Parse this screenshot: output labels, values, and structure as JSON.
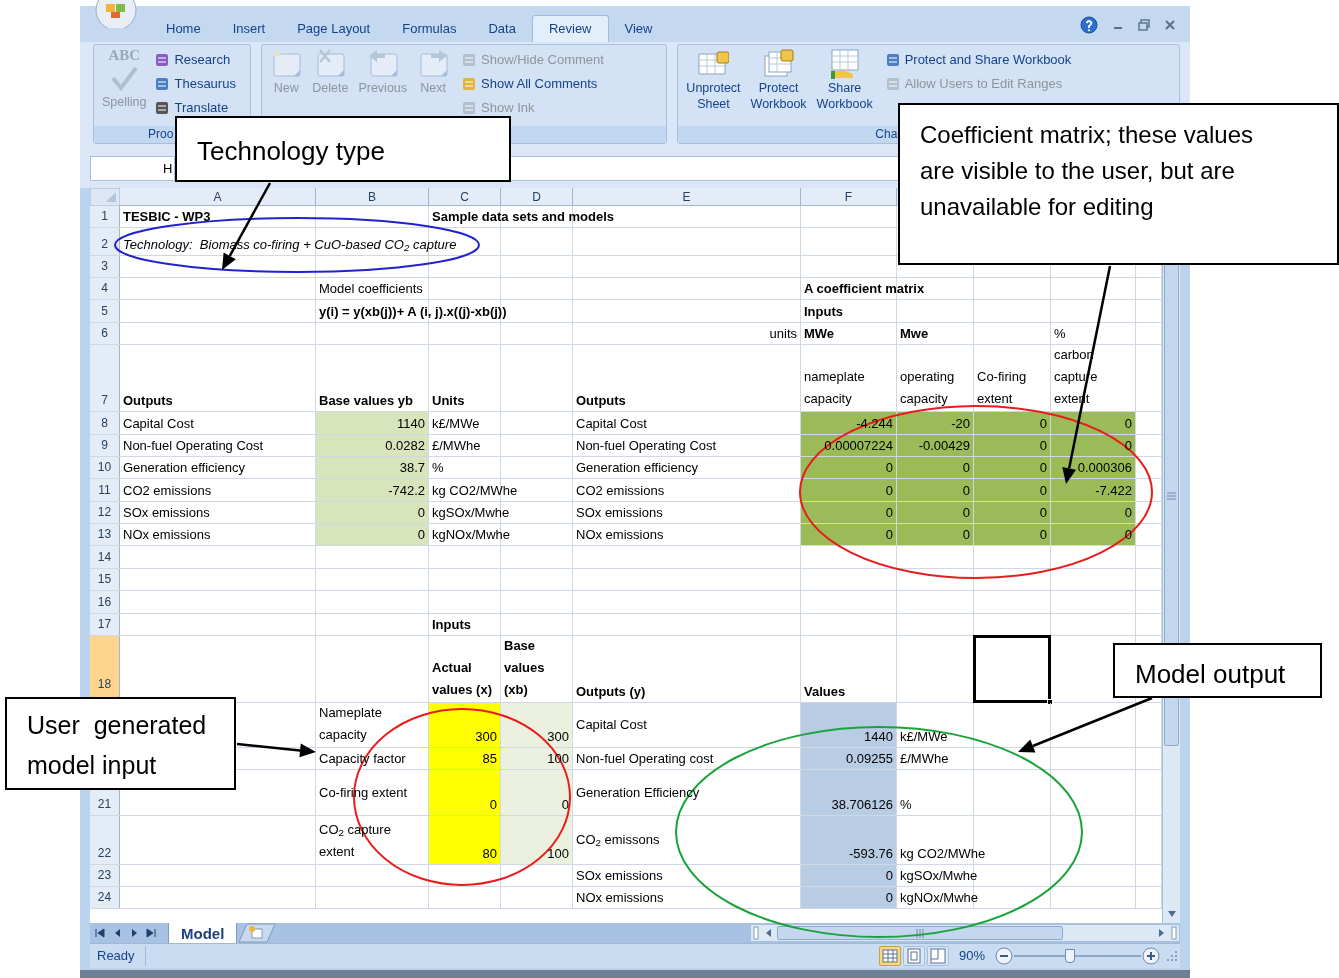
{
  "ribbon": {
    "tabs": [
      {
        "label": "Home",
        "selected": false
      },
      {
        "label": "Insert",
        "selected": false
      },
      {
        "label": "Page Layout",
        "selected": false
      },
      {
        "label": "Formulas",
        "selected": false
      },
      {
        "label": "Data",
        "selected": false
      },
      {
        "label": "Review",
        "selected": true
      },
      {
        "label": "View",
        "selected": false
      }
    ],
    "groups": [
      {
        "label": "Proo",
        "large_buttons": [
          {
            "label": "Spelling",
            "icon_text": "ABC",
            "disabled": true
          }
        ],
        "small_buttons": [
          {
            "label": "Research",
            "disabled": false
          },
          {
            "label": "Thesaurus",
            "disabled": false
          },
          {
            "label": "Translate",
            "disabled": false
          }
        ]
      },
      {
        "large_buttons": [
          {
            "label": "New",
            "disabled": true
          },
          {
            "label": "Delete",
            "disabled": true
          },
          {
            "label": "Previous",
            "disabled": true
          },
          {
            "label": "Next",
            "disabled": true
          }
        ],
        "small_buttons": [
          {
            "label": "Show/Hide Comment",
            "disabled": true
          },
          {
            "label": "Show All Comments",
            "disabled": false
          },
          {
            "label": "Show Ink",
            "disabled": true
          }
        ]
      },
      {
        "label": "Cha",
        "large_buttons": [
          {
            "label": "Unprotect Sheet",
            "disabled": false
          },
          {
            "label": "Protect Workbook",
            "disabled": false
          },
          {
            "label": "Share Workbook",
            "disabled": false
          }
        ],
        "small_buttons": [
          {
            "label": "Protect and Share Workbook",
            "disabled": false
          },
          {
            "label": "Allow Users to Edit Ranges",
            "disabled": true
          }
        ]
      }
    ]
  },
  "formula_bar": {
    "name_box": "H"
  },
  "sheet": {
    "columns": [
      "A",
      "B",
      "C",
      "D",
      "E",
      "F"
    ],
    "rows": [
      {
        "number": "1",
        "cells": {
          "col_a": {
            "text": "TESBIC - WP3",
            "bold": true
          },
          "col_c": {
            "text": "Sample data sets and models",
            "bold": true
          }
        }
      },
      {
        "number": "2",
        "cells": {
          "col_a": {
            "text": "Technology:  Biomass co-firing + CuO-based CO$_{2}$ capture",
            "italic": true
          }
        }
      },
      {
        "number": "3"
      },
      {
        "number": "4",
        "cells": {
          "col_b": {
            "text": "Model coefficients"
          },
          "col_f": {
            "text": "A coefficient matrix",
            "bold": true
          }
        }
      },
      {
        "number": "5",
        "cells": {
          "col_b": {
            "text": "y(i) = y(xb(j))+ A (i, j).x((j)-xb(j))",
            "bold": true
          },
          "col_f": {
            "text": "Inputs",
            "bold": true
          }
        }
      },
      {
        "number": "6",
        "cells": {
          "col_e": {
            "text": "units",
            "right_aligned": true
          },
          "col_f": {
            "text": "MWe",
            "bold": true
          },
          "col_g": {
            "text": "Mwe",
            "bold": true
          },
          "col_i": {
            "text": "%"
          }
        }
      },
      {
        "number": "7",
        "cells": {
          "col_a": {
            "text": "Outputs",
            "bold": true
          },
          "col_b": {
            "text": "Base values yb",
            "bold": true
          },
          "col_c": {
            "text": "Units",
            "bold": true
          },
          "col_e": {
            "text": "Outputs",
            "bold": true
          },
          "col_f": {
            "text": "nameplate capacity",
            "wrap": true
          },
          "col_g": {
            "text": "operating capacity",
            "wrap": true
          },
          "col_h": {
            "text": "Co-firing extent",
            "wrap": true
          },
          "col_i": {
            "text": "carbon capture extent",
            "wrap": true
          }
        }
      },
      {
        "number": "8",
        "cells": {
          "col_a": {
            "text": "Capital Cost"
          },
          "col_b": {
            "text": "1140",
            "right_aligned": true,
            "color": "#d8e4bc"
          },
          "col_c": {
            "text": "k£/MWe"
          },
          "col_e": {
            "text": "Capital Cost"
          },
          "col_f": {
            "text": "-4.244",
            "right_aligned": true,
            "color": "#9bbb59"
          },
          "col_g": {
            "text": "-20",
            "right_aligned": true,
            "color": "#9bbb59"
          },
          "col_h": {
            "text": "0",
            "right_aligned": true,
            "color": "#9bbb59"
          },
          "col_i": {
            "text": "0",
            "right_aligned": true,
            "color": "#9bbb59"
          }
        }
      },
      {
        "number": "9",
        "cells": {
          "col_a": {
            "text": "Non-fuel Operating Cost"
          },
          "col_b": {
            "text": "0.0282",
            "right_aligned": true,
            "color": "#d8e4bc"
          },
          "col_c": {
            "text": "£/MWhe"
          },
          "col_e": {
            "text": "Non-fuel Operating Cost"
          },
          "col_f": {
            "text": "0.00007224",
            "right_aligned": true,
            "color": "#9bbb59"
          },
          "col_g": {
            "text": "-0.00429",
            "right_aligned": true,
            "color": "#9bbb59"
          },
          "col_h": {
            "text": "0",
            "right_aligned": true,
            "color": "#9bbb59"
          },
          "col_i": {
            "text": "0",
            "right_aligned": true,
            "color": "#9bbb59"
          }
        }
      },
      {
        "number": "10",
        "cells": {
          "col_a": {
            "text": "Generation efficiency"
          },
          "col_b": {
            "text": "38.7",
            "right_aligned": true,
            "color": "#d8e4bc"
          },
          "col_c": {
            "text": "%"
          },
          "col_e": {
            "text": "Generation efficiency"
          },
          "col_f": {
            "text": "0",
            "right_aligned": true,
            "color": "#9bbb59"
          },
          "col_g": {
            "text": "0",
            "right_aligned": true,
            "color": "#9bbb59"
          },
          "col_h": {
            "text": "0",
            "right_aligned": true,
            "color": "#9bbb59"
          },
          "col_i": {
            "text": "0.000306",
            "right_aligned": true,
            "color": "#9bbb59"
          }
        }
      },
      {
        "number": "11",
        "cells": {
          "col_a": {
            "text": "CO2 emissions"
          },
          "col_b": {
            "text": "-742.2",
            "right_aligned": true,
            "color": "#d8e4bc"
          },
          "col_c": {
            "text": "kg CO2/MWhe"
          },
          "col_e": {
            "text": "CO2 emissions"
          },
          "col_f": {
            "text": "0",
            "right_aligned": true,
            "color": "#9bbb59"
          },
          "col_g": {
            "text": "0",
            "right_aligned": true,
            "color": "#9bbb59"
          },
          "col_h": {
            "text": "0",
            "right_aligned": true,
            "color": "#9bbb59"
          },
          "col_i": {
            "text": "-7.422",
            "right_aligned": true,
            "color": "#9bbb59"
          }
        }
      },
      {
        "number": "12",
        "cells": {
          "col_a": {
            "text": "SOx emissions"
          },
          "col_b": {
            "text": "0",
            "right_aligned": true,
            "color": "#d8e4bc"
          },
          "col_c": {
            "text": "kgSOx/Mwhe"
          },
          "col_e": {
            "text": "SOx emissions"
          },
          "col_f": {
            "text": "0",
            "right_aligned": true,
            "color": "#9bbb59"
          },
          "col_g": {
            "text": "0",
            "right_aligned": true,
            "color": "#9bbb59"
          },
          "col_h": {
            "text": "0",
            "right_aligned": true,
            "color": "#9bbb59"
          },
          "col_i": {
            "text": "0",
            "right_aligned": true,
            "color": "#9bbb59"
          }
        }
      },
      {
        "number": "13",
        "cells": {
          "col_a": {
            "text": "NOx emissions"
          },
          "col_b": {
            "text": "0",
            "right_aligned": true,
            "color": "#d8e4bc"
          },
          "col_c": {
            "text": "kgNOx/Mwhe"
          },
          "col_e": {
            "text": "NOx emissions"
          },
          "col_f": {
            "text": "0",
            "right_aligned": true,
            "color": "#9bbb59"
          },
          "col_g": {
            "text": "0",
            "right_aligned": true,
            "color": "#9bbb59"
          },
          "col_h": {
            "text": "0",
            "right_aligned": true,
            "color": "#9bbb59"
          },
          "col_i": {
            "text": "0",
            "right_aligned": true,
            "color": "#9bbb59"
          }
        }
      },
      {
        "number": "14"
      },
      {
        "number": "15"
      },
      {
        "number": "16"
      },
      {
        "number": "17",
        "cells": {
          "col_c": {
            "text": "Inputs",
            "bold": true
          }
        }
      },
      {
        "number": "18",
        "cells": {
          "col_c": {
            "text": "Actual values (x)",
            "bold": true,
            "wrap": true
          },
          "col_d": {
            "text": "Base values (xb)",
            "bold": true,
            "wrap": true
          },
          "col_e": {
            "text": "Outputs (y)",
            "bold": true
          },
          "col_f": {
            "text": "Values",
            "bold": true
          },
          "col_h": {
            "selected": true
          }
        }
      },
      {
        "cells": {
          "col_b": {
            "text": "Nameplate capacity",
            "wrap": true
          },
          "col_c": {
            "text": "300",
            "right_aligned": true,
            "color": "#ffff00"
          },
          "col_d": {
            "text": "300",
            "right_aligned": true,
            "color": "#ebf1de"
          },
          "col_e": {
            "text": "Capital Cost",
            "middle": true
          },
          "col_f": {
            "text": "1440",
            "right_aligned": true,
            "color": "#b8cce4"
          },
          "col_g": {
            "text": "k£/MWe"
          }
        }
      },
      {
        "cells": {
          "col_b": {
            "text": "Capacity factor"
          },
          "col_c": {
            "text": "85",
            "right_aligned": true,
            "color": "#ffff00"
          },
          "col_d": {
            "text": "100",
            "right_aligned": true,
            "color": "#ebf1de"
          },
          "col_e": {
            "text": "Non-fuel Operating cost"
          },
          "col_f": {
            "text": "0.09255",
            "right_aligned": true,
            "color": "#b8cce4"
          },
          "col_g": {
            "text": "£/MWhe"
          }
        }
      },
      {
        "number": "21",
        "cells": {
          "col_b": {
            "text": "Co-firing extent",
            "middle": true
          },
          "col_c": {
            "text": "0",
            "right_aligned": true,
            "color": "#ffff00"
          },
          "col_d": {
            "text": "0",
            "right_aligned": true,
            "color": "#ebf1de"
          },
          "col_e": {
            "text": "Generation Efficiency",
            "middle": true
          },
          "col_f": {
            "text": "38.706126",
            "right_aligned": true,
            "color": "#b8cce4"
          },
          "col_g": {
            "text": "%"
          }
        }
      },
      {
        "number": "22",
        "cells": {
          "col_b": {
            "text": "CO$_{2}$ capture extent",
            "wrap": true
          },
          "col_c": {
            "text": "80",
            "right_aligned": true,
            "color": "#ffff00"
          },
          "col_d": {
            "text": "100",
            "right_aligned": true,
            "color": "#ebf1de"
          },
          "col_e": {
            "text": "CO$_{2}$ emissons",
            "middle": true
          },
          "col_f": {
            "text": "-593.76",
            "right_aligned": true,
            "color": "#b8cce4"
          },
          "col_g": {
            "text": "kg CO2/MWhe"
          }
        }
      },
      {
        "number": "23",
        "cells": {
          "col_e": {
            "text": "SOx emissions"
          },
          "col_f": {
            "text": "0",
            "right_aligned": true,
            "color": "#b8cce4"
          },
          "col_g": {
            "text": "kgSOx/Mwhe"
          }
        }
      },
      {
        "number": "24",
        "cells": {
          "col_e": {
            "text": "NOx emissions"
          },
          "col_f": {
            "text": "0",
            "right_aligned": true,
            "color": "#b8cce4"
          },
          "col_g": {
            "text": "kgNOx/Mwhe"
          }
        }
      }
    ]
  },
  "sheet_tabs": [
    {
      "label": "Model",
      "selected": true
    }
  ],
  "status_bar": {
    "text": "Ready",
    "view_buttons": [
      {
        "selected": true
      },
      {
        "selected": false
      },
      {
        "selected": false
      }
    ],
    "zoom": "90%",
    "zoom_slider": {
      "level": 0.44
    }
  },
  "annotations": [
    {
      "text": "Technology type"
    },
    {
      "text": "Coefficient matrix; these values are visible to the user, but are unavailable for editing"
    },
    {
      "text": "Model output"
    },
    {
      "text": "User  generated model input"
    }
  ]
}
